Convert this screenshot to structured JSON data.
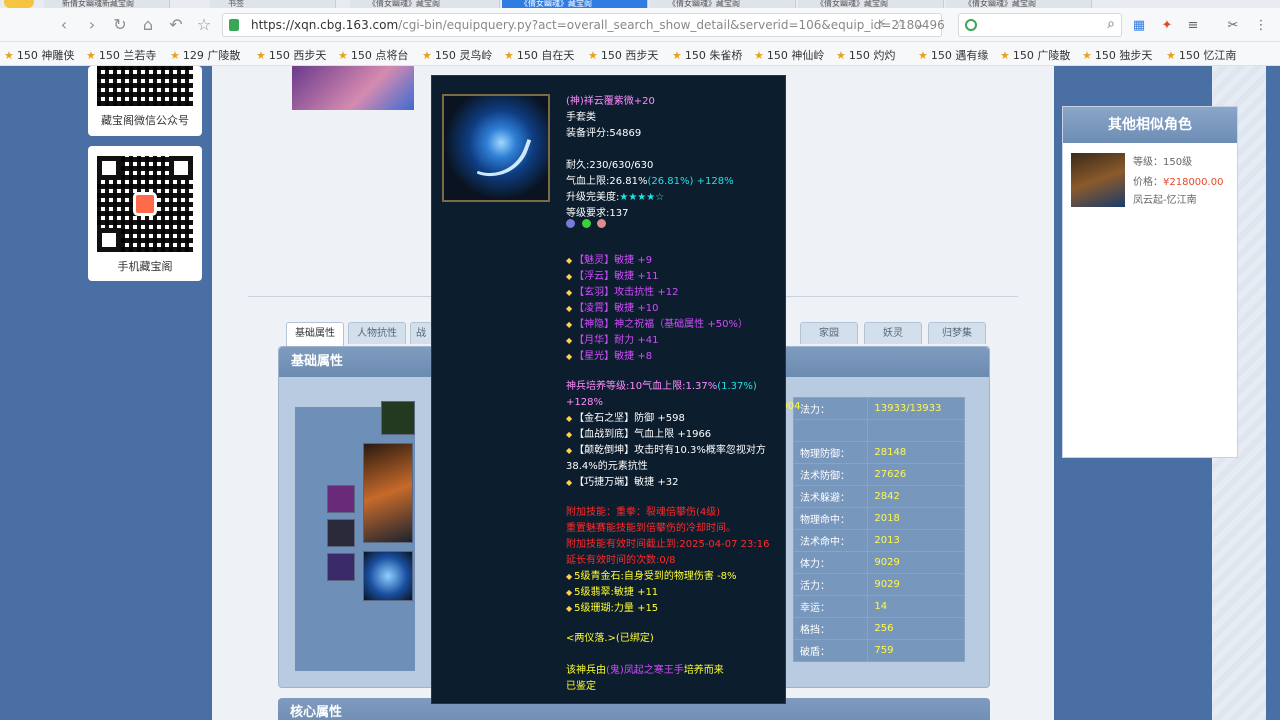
{
  "browser": {
    "tabs": [
      {
        "label": "新倩女幽魂新藏宝阁"
      },
      {
        "label": "书签"
      },
      {
        "label": "《倩女幽魂》藏宝阁"
      },
      {
        "label": "《倩女幽魂》藏宝阁"
      },
      {
        "label": "《倩女幽魂》藏宝阁"
      },
      {
        "label": "《倩女幽魂》藏宝阁"
      },
      {
        "label": "《倩女幽魂》藏宝阁"
      }
    ],
    "url_host": "https://xqn.cbg.163.com",
    "url_path": "/cgi-bin/equipquery.py?act=overall_search_show_detail&serverid=106&equip_id=2180496",
    "bookmarks": [
      "150 神雕侠",
      "150 兰若寺",
      "129 广陵散",
      "150 西步天",
      "150 点将台",
      "150 灵鸟岭",
      "150 自在天",
      "150 西步天",
      "150 朱雀桥",
      "150 神仙岭",
      "150 灼灼",
      "150 遇有缘",
      "150 广陵散",
      "150 独步天",
      "150 忆江南"
    ]
  },
  "left": {
    "wechat_caption": "藏宝阁微信公众号",
    "mobile_caption": "手机藏宝阁"
  },
  "tabs": [
    "基础属性",
    "人物抗性",
    "战",
    "家园",
    "妖灵",
    "归梦集"
  ],
  "panel": {
    "title": "基础属性",
    "stats": [
      {
        "label": "法力：",
        "value": "13933/13933",
        "lead": "5904"
      },
      {
        "label": "",
        "value": ""
      },
      {
        "label": "物理防御：",
        "value": "28148"
      },
      {
        "label": "法术防御：",
        "value": "27626"
      },
      {
        "label": "法术躲避：",
        "value": "2842"
      },
      {
        "label": "物理命中：",
        "value": "2018"
      },
      {
        "label": "法术命中：",
        "value": "2013"
      },
      {
        "label": "体力：",
        "value": "9029"
      },
      {
        "label": "活力：",
        "value": "9029"
      },
      {
        "label": "幸运：",
        "value": "14"
      },
      {
        "label": "格挡：",
        "value": "256"
      },
      {
        "label": "破盾：",
        "value": "759"
      }
    ]
  },
  "panel2_title": "核心属性",
  "similar": {
    "title": "其他相似角色",
    "level": "等级：150级",
    "price_label": "价格：",
    "price": "¥218000.00",
    "server": "凤云起-忆江南"
  },
  "tooltip": {
    "name": "(神)祥云覆紫微+20",
    "category": "手套类",
    "score": "装备评分:54869",
    "durability": "耐久:230/630/630",
    "hp_line_a": "气血上限:26.81%",
    "hp_line_b": "(26.81%)",
    "hp_line_c": "+128%",
    "upgrade_label": "升级完美度:",
    "upgrade_stars": "★★★★☆",
    "level_req": "等级要求:137",
    "attrs": [
      "【魅灵】敏捷 +9",
      "【浮云】敏捷 +11",
      "【玄羽】攻击抗性 +12",
      "【凌霄】敏捷 +10",
      "【神隐】神之祝福（基础属性 +50%）",
      "【月华】耐力 +41",
      "【星光】敏捷 +8"
    ],
    "cultivate_a": "神兵培养等级:10气血上限:1.37%",
    "cultivate_b": "(1.37%)",
    "cultivate_c": "+128%",
    "bonus": [
      "【金石之坚】防御 +598",
      "【血战到底】气血上限 +1966",
      "【颠乾倒坤】攻击时有10.3%概率忽视对方",
      "38.4%的元素抗性",
      "【巧捷万端】敏捷 +32"
    ],
    "red_lines": [
      "附加技能：重拳：裂魂倍攀伤(4级)",
      "重置魅赛能技能到倍攀伤的冷却时间。",
      "附加技能有效时间截止到:2025-04-07 23:16",
      "延长有效时间的次数:0/8"
    ],
    "gems": [
      "5级青金石:自身受到的物理伤害 -8%",
      "5级翡翠:敏捷 +11",
      "5级珊瑚:力量 +15"
    ],
    "bind": "<两仪落.>(已绑定)",
    "origin_a": "该神兵由",
    "origin_b": "(鬼)",
    "origin_c": "凤起之寒王手",
    "origin_d": "培养而来",
    "appraised": "已鉴定"
  },
  "colors": {
    "page_bg": "#4a6fa5",
    "tooltip_bg": "#0c1d2e",
    "accent_tab": "#2f7de1"
  }
}
